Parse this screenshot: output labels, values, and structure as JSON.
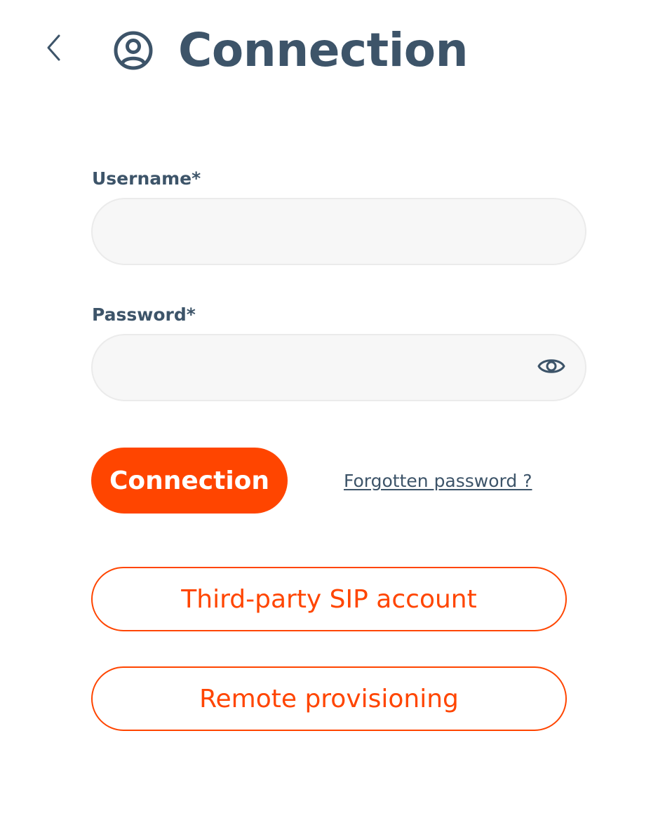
{
  "header": {
    "back_icon": "chevron-left-icon",
    "title_icon": "user-circle-icon",
    "title": "Connection"
  },
  "form": {
    "username": {
      "label": "Username*",
      "value": "",
      "placeholder": ""
    },
    "password": {
      "label": "Password*",
      "value": "",
      "placeholder": "",
      "toggle_icon": "eye-icon"
    },
    "submit_label": "Connection",
    "forgot_password_label": "Forgotten password ?"
  },
  "alternatives": {
    "sip_label": "Third-party SIP account",
    "provisioning_label": "Remote provisioning"
  },
  "colors": {
    "accent": "#ff4500",
    "text": "#3d5469",
    "field_background": "#f7f7f7",
    "field_border": "#ebebeb"
  }
}
